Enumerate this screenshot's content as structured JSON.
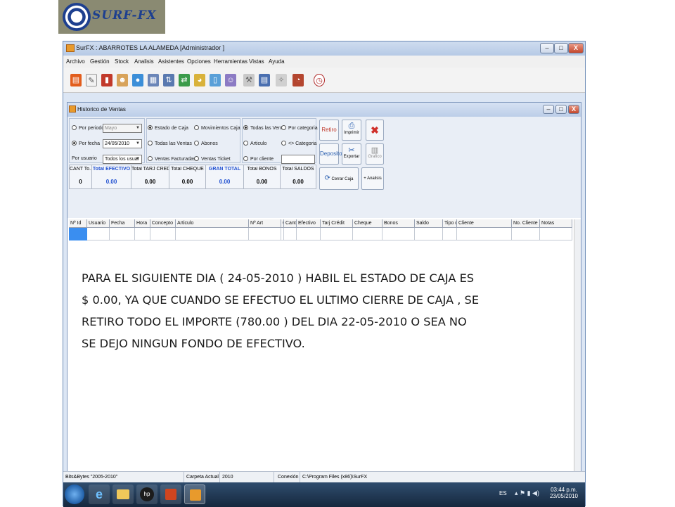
{
  "logo": {
    "text": "SURF-FX"
  },
  "window": {
    "title": "SurFX :  ABARROTES LA ALAMEDA [Administrador ]",
    "controls": [
      "–",
      "□",
      "X"
    ]
  },
  "menu": [
    "Archivo",
    "Gestión",
    "Stock",
    "Analisis",
    "Asistentes",
    "Opciones",
    "Herramientas",
    "Vistas",
    "Ayuda"
  ],
  "toolbar_icons": [
    "document-icon",
    "edit-icon",
    "book-icon",
    "user-icon",
    "palette-icon",
    "calculator-icon",
    "transfer-icon",
    "arrows-icon",
    "chart-icon",
    "bottle-icon",
    "user-group-icon",
    "tools-icon",
    "ledger-icon",
    "magic-icon",
    "chart-pie-icon",
    "clock-icon"
  ],
  "mdi": {
    "title": "Historico de Ventas",
    "controls": [
      "–",
      "□",
      "X"
    ]
  },
  "filters": {
    "por_periodo": {
      "label": "Por periodo",
      "value": "Mayo"
    },
    "por_fecha": {
      "label": "Por fecha",
      "value": "24/05/2010"
    },
    "por_usuario": {
      "label": "Por usuario",
      "value": "Todos los usuar"
    },
    "group2": [
      "Estado de Caja",
      "Movimientos Caja",
      "Todas las Ventas",
      "Abonos",
      "Ventas Facturadas",
      "Ventas Ticket"
    ],
    "group3": [
      "Todas las Venti",
      "Por categoria",
      "Articulo",
      "<> Categoria",
      "Por cliente"
    ]
  },
  "actions": {
    "retiro": "Retiro",
    "imprimir": "Imprimir",
    "deposito": "Deposito",
    "exportar": "Exportar",
    "grafico": "Grafico",
    "cerrar_caja": "Cerrar Caja",
    "analisis": "+ Analisis"
  },
  "totals": {
    "headers": [
      "CANT To...",
      "Total EFECTIVO",
      "Total TARJ CREDIT",
      "Total CHEQUE",
      "GRAN TOTAL",
      "Total BONOS",
      "Total  SALDOS"
    ],
    "values": [
      "0",
      "0.00",
      "0.00",
      "0.00",
      "0.00",
      "0.00",
      "0.00"
    ]
  },
  "grid": {
    "columns": [
      "Nº Id",
      "Usuario",
      "Fecha",
      "Hora",
      "Concepto",
      "Articulo",
      "Nº Art",
      "C",
      "Cant",
      "Efectivo",
      "Tarj Crédit",
      "Cheque",
      "Bonos",
      "Saldo",
      "Tipo d",
      "Cliente",
      "No. Cliente",
      "Notas"
    ]
  },
  "note": "PARA EL SIGUIENTE DIA ( 24-05-2010 ) HABIL EL ESTADO DE CAJA ES\n$ 0.00, YA QUE CUANDO SE EFECTUO EL ULTIMO CIERRE DE CAJA , SE\nRETIRO TODO EL IMPORTE (780.00 ) DEL DIA 22-05-2010 O SEA NO\nSE DEJO NINGUN FONDO DE EFECTIVO.",
  "statusbar": {
    "version": "Bits&Bytes \"2005-2010\"",
    "carpeta_label": "Carpeta Actual",
    "carpeta_value": "2010",
    "conexion_label": "Conexión",
    "conexion_value": "C:\\Program Files (x86)\\SurFX"
  },
  "taskbar": {
    "lang": "ES",
    "time": "03:44 p.m.",
    "date": "23/05/2010",
    "apps": [
      "start-orb-icon",
      "internet-explorer-icon",
      "folder-icon",
      "hp-icon",
      "presentation-icon",
      "surfx-icon"
    ]
  },
  "colors": {
    "accent": "#1d3f8f",
    "gran_total": "#1f4fd0",
    "titlebar": "#c4d4ec",
    "taskbar": "#1e3552"
  }
}
